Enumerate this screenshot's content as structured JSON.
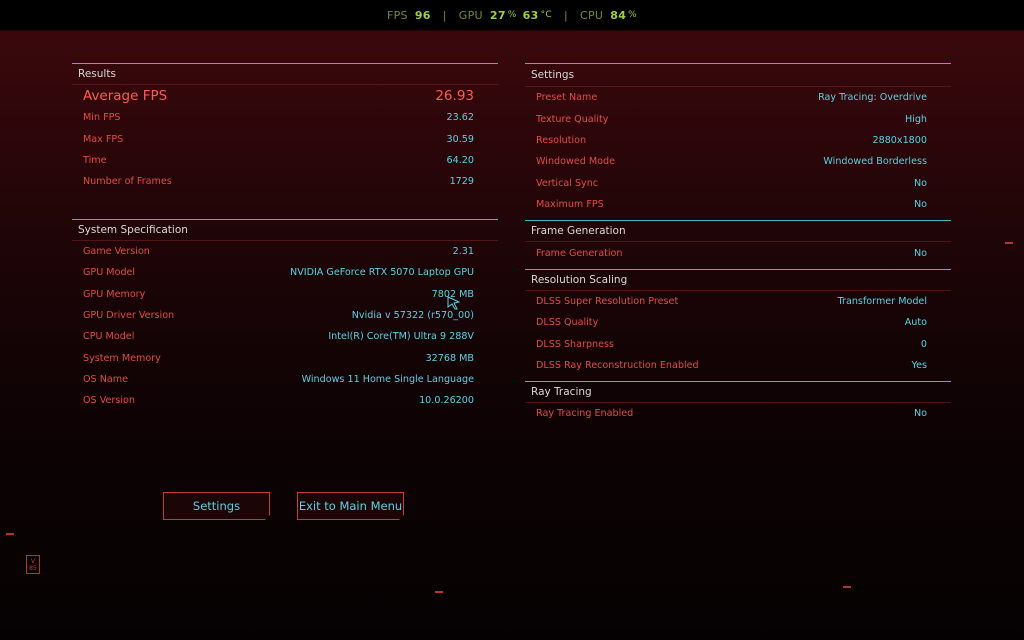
{
  "overlay": {
    "fps_label": "FPS",
    "fps_value": "96",
    "gpu_label": "GPU",
    "gpu_usage": "27",
    "gpu_usage_unit": "%",
    "gpu_temp": "63",
    "gpu_temp_unit": "°C",
    "cpu_label": "CPU",
    "cpu_usage": "84",
    "cpu_usage_unit": "%"
  },
  "results": {
    "title": "Results",
    "rows": [
      {
        "label": "Average FPS",
        "value": "26.93"
      },
      {
        "label": "Min FPS",
        "value": "23.62"
      },
      {
        "label": "Max FPS",
        "value": "30.59"
      },
      {
        "label": "Time",
        "value": "64.20"
      },
      {
        "label": "Number of Frames",
        "value": "1729"
      }
    ]
  },
  "system": {
    "title": "System Specification",
    "rows": [
      {
        "label": "Game Version",
        "value": "2.31"
      },
      {
        "label": "GPU Model",
        "value": "NVIDIA GeForce RTX 5070 Laptop GPU"
      },
      {
        "label": "GPU Memory",
        "value": "7802 MB"
      },
      {
        "label": "GPU Driver Version",
        "value": "Nvidia v 57322 (r570_00)"
      },
      {
        "label": "CPU Model",
        "value": "Intel(R) Core(TM) Ultra 9 288V"
      },
      {
        "label": "System Memory",
        "value": "32768 MB"
      },
      {
        "label": "OS Name",
        "value": "Windows 11 Home Single Language"
      },
      {
        "label": "OS Version",
        "value": "10.0.26200"
      }
    ]
  },
  "settings": {
    "title": "Settings",
    "rows": [
      {
        "label": "Preset Name",
        "value": "Ray Tracing: Overdrive"
      },
      {
        "label": "Texture Quality",
        "value": "High"
      },
      {
        "label": "Resolution",
        "value": "2880x1800"
      },
      {
        "label": "Windowed Mode",
        "value": "Windowed Borderless"
      },
      {
        "label": "Vertical Sync",
        "value": "No"
      },
      {
        "label": "Maximum FPS",
        "value": "No"
      }
    ]
  },
  "frame_generation": {
    "title": "Frame Generation",
    "rows": [
      {
        "label": "Frame Generation",
        "value": "No"
      }
    ]
  },
  "resolution_scaling": {
    "title": "Resolution Scaling",
    "rows": [
      {
        "label": "DLSS Super Resolution Preset",
        "value": "Transformer Model"
      },
      {
        "label": "DLSS Quality",
        "value": "Auto"
      },
      {
        "label": "DLSS Sharpness",
        "value": "0"
      },
      {
        "label": "DLSS Ray Reconstruction Enabled",
        "value": "Yes"
      }
    ]
  },
  "ray_tracing": {
    "title": "Ray Tracing",
    "rows": [
      {
        "label": "Ray Tracing Enabled",
        "value": "No"
      }
    ]
  },
  "buttons": {
    "settings": "Settings",
    "exit": "Exit to Main Menu"
  },
  "badge": {
    "top": "V",
    "bottom": "85"
  },
  "colors": {
    "label": "#e24b48",
    "value": "#58d3e3",
    "accent_line": "#3fb8c6",
    "overlay": "#9fd03d"
  },
  "icons": [
    "mouse-cursor-icon"
  ]
}
